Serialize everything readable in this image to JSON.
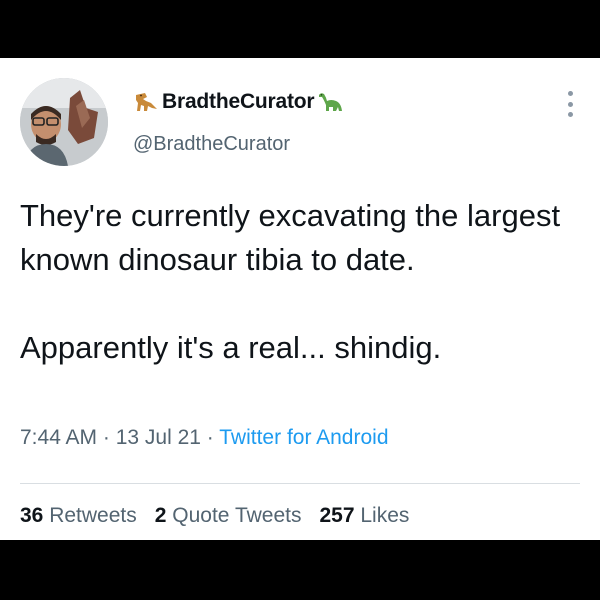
{
  "tweet": {
    "author": {
      "display_name": "BradtheCurator",
      "handle": "@BradtheCurator",
      "name_emojis": [
        "t-rex-icon",
        "sauropod-icon"
      ]
    },
    "text": {
      "paragraph_1": "They're currently excavating the largest known dinosaur tibia to date.",
      "paragraph_2": "Apparently it's a real... shindig."
    },
    "meta": {
      "time": "7:44 AM",
      "date": "13 Jul 21",
      "separator": " · ",
      "source": "Twitter for Android"
    },
    "stats": {
      "retweets_count": "36",
      "retweets_label": "Retweets",
      "quote_count": "2",
      "quote_label": "Quote Tweets",
      "likes_count": "257",
      "likes_label": "Likes"
    }
  },
  "colors": {
    "text_primary": "#0f1419",
    "text_secondary": "#536471",
    "link": "#1d9bf0",
    "dinosaur_orange": "#c98a3a",
    "dinosaur_green": "#5ea64a"
  }
}
